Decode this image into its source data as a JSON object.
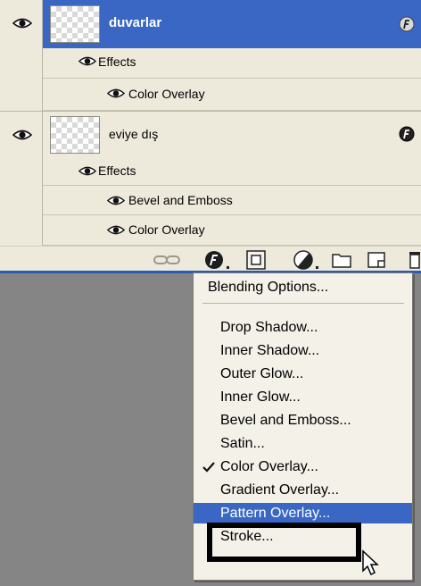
{
  "layers": [
    {
      "name": "duvarlar",
      "selected": true,
      "visible": true,
      "effects_label": "Effects",
      "effects": [
        "Color Overlay"
      ]
    },
    {
      "name": "eviye dış",
      "selected": false,
      "visible": true,
      "effects_label": "Effects",
      "effects": [
        "Bevel and Emboss",
        "Color Overlay"
      ]
    }
  ],
  "toolbar": {
    "buttons": [
      "link-icon",
      "layer-style-icon",
      "layer-mask-icon",
      "adjustment-layer-icon",
      "new-group-icon",
      "new-layer-icon",
      "delete-icon"
    ]
  },
  "menu": {
    "blending_options": "Blending Options...",
    "items": [
      "Drop Shadow...",
      "Inner Shadow...",
      "Outer Glow...",
      "Inner Glow...",
      "Bevel and Emboss...",
      "Satin...",
      "Color Overlay...",
      "Gradient Overlay...",
      "Pattern Overlay...",
      "Stroke..."
    ],
    "checked_item": "Color Overlay...",
    "highlighted_item": "Pattern Overlay..."
  },
  "colors": {
    "selection": "#3a67c4",
    "panel": "#eeeadb",
    "canvas": "#858585"
  }
}
